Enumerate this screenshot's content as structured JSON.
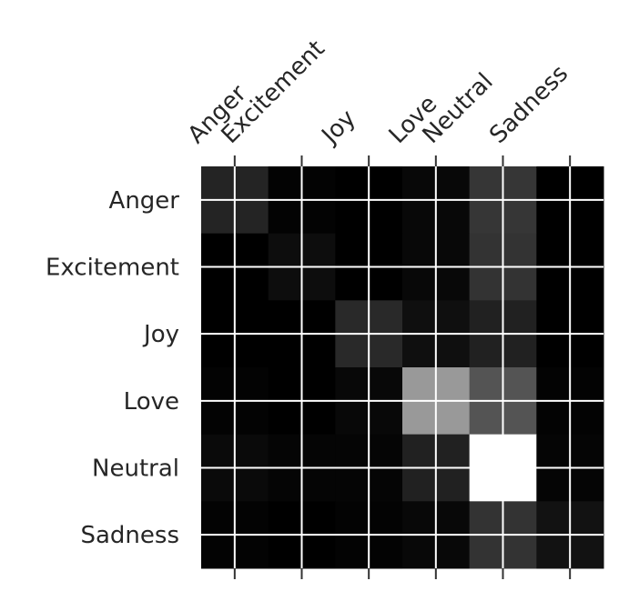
{
  "chart_data": {
    "type": "heatmap",
    "colormap": "gray",
    "x_labels": [
      "Anger",
      "Excitement",
      "Joy",
      "Love",
      "Neutral",
      "Sadness"
    ],
    "y_labels": [
      "Anger",
      "Excitement",
      "Joy",
      "Love",
      "Neutral",
      "Sadness"
    ],
    "x_label_positions": [
      0,
      0.5,
      2,
      3,
      3.5,
      4.5
    ],
    "values": [
      [
        0.14,
        0.01,
        0.0,
        0.03,
        0.21,
        0.0
      ],
      [
        0.0,
        0.05,
        0.0,
        0.03,
        0.2,
        0.0
      ],
      [
        0.0,
        0.0,
        0.16,
        0.06,
        0.13,
        0.0
      ],
      [
        0.01,
        0.0,
        0.03,
        0.6,
        0.33,
        0.01
      ],
      [
        0.04,
        0.02,
        0.02,
        0.13,
        1.0,
        0.02
      ],
      [
        0.01,
        0.0,
        0.01,
        0.03,
        0.2,
        0.07
      ]
    ],
    "value_range": [
      0,
      1
    ],
    "grid": true
  }
}
